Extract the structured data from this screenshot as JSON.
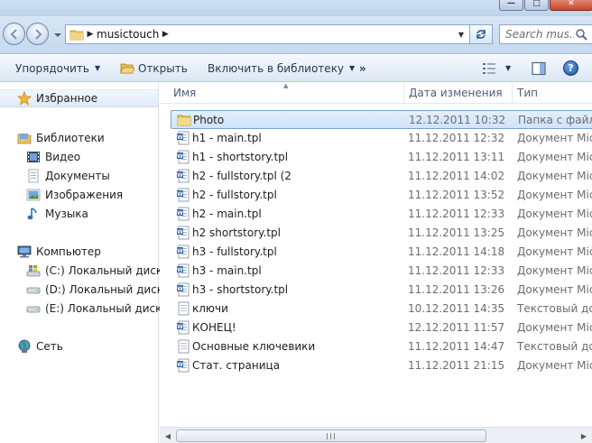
{
  "window": {
    "controls": [
      "minimize",
      "maximize",
      "close"
    ],
    "accent_color": "#3165a8"
  },
  "address": {
    "crumb": "musictouch",
    "search_placeholder": "Search mus..."
  },
  "toolbar": {
    "organize": "Упорядочить",
    "open": "Открыть",
    "include": "Включить в библиотеку",
    "more": "»"
  },
  "nav": {
    "favorites": "Избранное",
    "libraries": "Библиотеки",
    "library_items": [
      "Видео",
      "Документы",
      "Изображения",
      "Музыка"
    ],
    "computer": "Компьютер",
    "drives": [
      "(C:) Локальный диск",
      "(D:) Локальный диск",
      "(E:) Локальный диск"
    ],
    "network": "Сеть"
  },
  "list": {
    "columns": [
      "Имя",
      "Дата изменения",
      "Тип"
    ],
    "rows": [
      {
        "name": "Photo",
        "date": "12.12.2011 10:32",
        "type": "Папка с файлами",
        "icon": "folder-icon",
        "selected": true
      },
      {
        "name": "h1 - main.tpl",
        "date": "11.12.2011 12:32",
        "type": "Документ Microsoft",
        "icon": "word-doc-icon"
      },
      {
        "name": "h1 - shortstory.tpl",
        "date": "11.12.2011 13:11",
        "type": "Документ Microsoft",
        "icon": "word-doc-icon"
      },
      {
        "name": "h2 - fullstory.tpl (2",
        "date": "11.12.2011 14:02",
        "type": "Документ Microsoft",
        "icon": "word-doc-icon"
      },
      {
        "name": "h2 - fullstory.tpl",
        "date": "11.12.2011 13:52",
        "type": "Документ Microsoft",
        "icon": "word-doc-icon"
      },
      {
        "name": "h2 - main.tpl",
        "date": "11.12.2011 12:33",
        "type": "Документ Microsoft",
        "icon": "word-doc-icon"
      },
      {
        "name": "h2 shortstory.tpl",
        "date": "11.12.2011 13:25",
        "type": "Документ Microsoft",
        "icon": "word-doc-icon"
      },
      {
        "name": "h3 - fullstory.tpl",
        "date": "11.12.2011 14:18",
        "type": "Документ Microsoft",
        "icon": "word-doc-icon"
      },
      {
        "name": "h3 - main.tpl",
        "date": "11.12.2011 12:33",
        "type": "Документ Microsoft",
        "icon": "word-doc-icon"
      },
      {
        "name": "h3 - shortstory.tpl",
        "date": "11.12.2011 13:26",
        "type": "Документ Microsoft",
        "icon": "word-doc-icon"
      },
      {
        "name": "ключи",
        "date": "10.12.2011 14:35",
        "type": "Текстовый документ",
        "icon": "text-doc-icon"
      },
      {
        "name": "КОНЕЦ!",
        "date": "12.12.2011 11:57",
        "type": "Документ Microsoft",
        "icon": "word-doc-icon"
      },
      {
        "name": "Основные ключевики",
        "date": "11.12.2011 14:47",
        "type": "Текстовый документ",
        "icon": "text-doc-icon"
      },
      {
        "name": "Стат. страница",
        "date": "11.12.2011 21:15",
        "type": "Документ Microsoft",
        "icon": "word-doc-icon"
      }
    ]
  }
}
